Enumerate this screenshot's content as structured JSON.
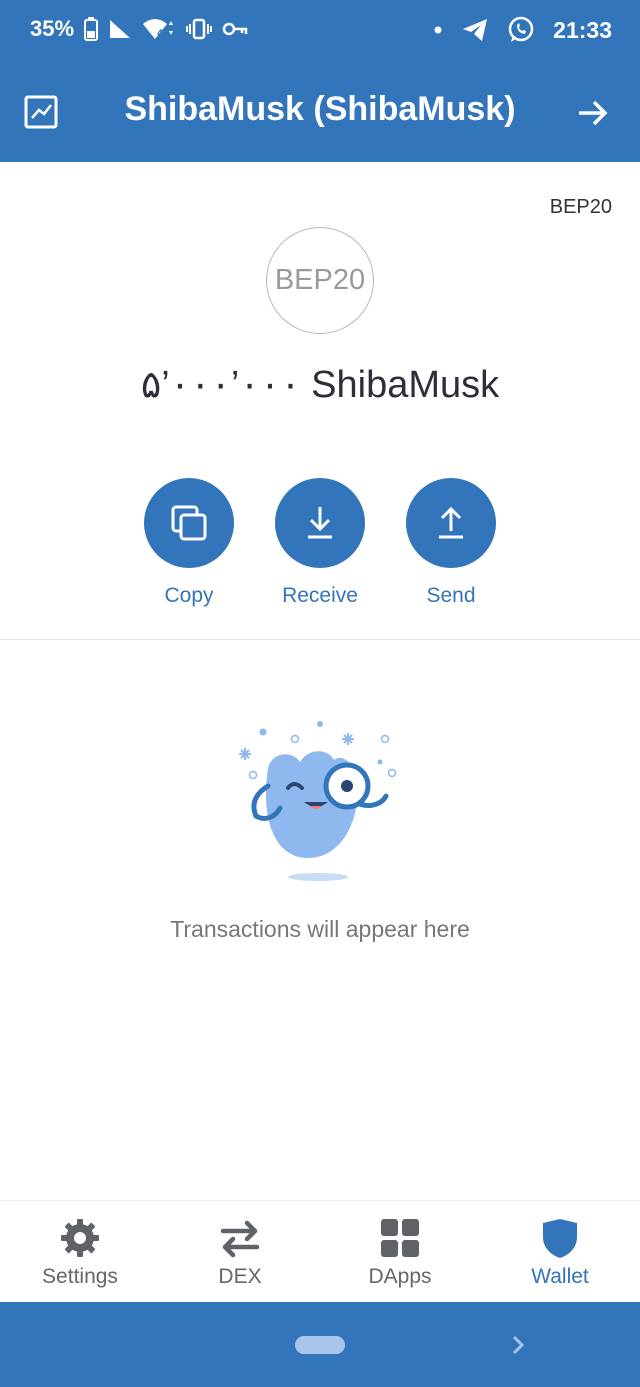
{
  "status_bar": {
    "battery_percent": "35%",
    "time": "21:33",
    "icons": [
      "battery-icon",
      "signal-icon",
      "wifi-icon",
      "vibrate-icon",
      "vpn-key-icon",
      "notification-dot-icon",
      "telegram-icon",
      "whatsapp-icon"
    ]
  },
  "app_bar": {
    "title": "ShibaMusk (ShibaMusk)",
    "left_icon": "chart-icon",
    "right_icon": "arrow-right-icon"
  },
  "token": {
    "network": "BEP20",
    "logo_text": "BEP20",
    "balance": "۵’۰۰۰’۰۰۰ ShibaMusk"
  },
  "actions": [
    {
      "label": "Copy",
      "icon": "copy-icon"
    },
    {
      "label": "Receive",
      "icon": "download-icon"
    },
    {
      "label": "Send",
      "icon": "upload-icon"
    }
  ],
  "empty_state": {
    "message": "Transactions will appear here"
  },
  "bottom_nav": {
    "items": [
      {
        "label": "Settings",
        "icon": "gear-icon",
        "active": false
      },
      {
        "label": "DEX",
        "icon": "swap-icon",
        "active": false
      },
      {
        "label": "DApps",
        "icon": "grid-icon",
        "active": false
      },
      {
        "label": "Wallet",
        "icon": "shield-icon",
        "active": true
      }
    ]
  },
  "colors": {
    "primary": "#3375bb",
    "active_nav": "#3375bb",
    "inactive_nav": "#666666",
    "illustration_fill": "#8fb9ee"
  }
}
